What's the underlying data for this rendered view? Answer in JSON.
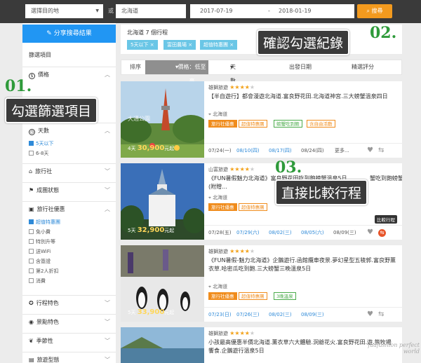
{
  "search": {
    "destination_placeholder": "選擇目的地",
    "or_label": "或",
    "keyword": "北海道",
    "date_from": "2017-07-19",
    "date_separator": "-",
    "date_to": "2018-01-19",
    "search_button": "搜尋"
  },
  "sidebar": {
    "share_button": "分享搜尋結果",
    "filter_heading": "篩選項目",
    "sections": [
      {
        "label": "價格",
        "icon": "dollar-icon"
      },
      {
        "label": "天數",
        "icon": "clock-icon",
        "options": [
          {
            "label": "5天以下",
            "checked": true
          },
          {
            "label": "6-8天",
            "checked": false
          }
        ]
      },
      {
        "label": "旅行社",
        "icon": "home-icon"
      },
      {
        "label": "成團狀態",
        "icon": "flag-icon"
      },
      {
        "label": "旅行社優惠",
        "icon": "gift-icon",
        "options": [
          {
            "label": "超值特惠團",
            "checked": true
          },
          {
            "label": "免小費",
            "checked": false
          },
          {
            "label": "特別升等",
            "checked": false
          },
          {
            "label": "送WiFi",
            "checked": false
          },
          {
            "label": "含簽證",
            "checked": false
          },
          {
            "label": "第2人折扣",
            "checked": false
          },
          {
            "label": "消費",
            "checked": false
          }
        ]
      },
      {
        "label": "行程特色",
        "icon": "star-icon"
      },
      {
        "label": "景點特色",
        "icon": "camera-icon"
      },
      {
        "label": "季節性",
        "icon": "leaf-icon"
      },
      {
        "label": "旅遊型態",
        "icon": "suitcase-icon"
      }
    ]
  },
  "filters": {
    "summary": "北海道 7 個行程",
    "chips": [
      "5天以下",
      "富田農場",
      "超值特惠團"
    ]
  },
  "sort": {
    "label": "排序",
    "active": "價格：低至高",
    "options": [
      "天數",
      "出發日期",
      "精選評分"
    ]
  },
  "results": [
    {
      "agency": "雄獅旅遊",
      "rating": 4,
      "title": "【半自遊行】都會漫遊北海道.富良野花田.北海道神宮.三大螃蟹溫泉四日",
      "location": "北海道",
      "tags": [
        {
          "label": "旅行社優惠",
          "style": "fill"
        },
        {
          "label": "超值特惠團",
          "style": "outline"
        },
        {
          "label": "螃蟹吃到飽",
          "style": "green"
        },
        {
          "label": "含自由活動",
          "style": "outline"
        }
      ],
      "days": "4天",
      "price": "30,900",
      "price_suffix": "元起",
      "photo_caption": "大通公園",
      "dates": [
        "07/24(一)",
        "08/10(四)",
        "08/17(四)",
        "08/24(四)"
      ],
      "more": "更多..."
    },
    {
      "agency": "山富旅遊",
      "rating": 4,
      "title": "《FUN暑假魅力北海道》富良野花田吃到飽螃蟹溫泉5日(附贈...",
      "title_right": "蟹吃到飽螃蟹溫泉",
      "location": "北海道",
      "tags": [
        {
          "label": "旅行社優惠",
          "style": "fill"
        },
        {
          "label": "超值特惠團",
          "style": "outline"
        }
      ],
      "days": "5天",
      "price": "32,900",
      "price_suffix": "元起",
      "dates": [
        "07/28(五)",
        "07/29(六)",
        "08/02(三)",
        "08/05(六)",
        "08/09(三)"
      ],
      "compare_tip": "比較行程"
    },
    {
      "agency": "雄獅旅遊",
      "rating": 4,
      "title": "《FUN暑假-魅力北海道》企鵝遊行.函館纜車夜景.夢幻星型五稜郭.富良野薰衣草.哈密瓜吃到飽.三大螃蟹三晚溫泉5日",
      "location": "北海道",
      "tags": [
        {
          "label": "旅行社優惠",
          "style": "fill"
        },
        {
          "label": "超值特惠團",
          "style": "outline"
        },
        {
          "label": "3晚溫泉",
          "style": "green"
        }
      ],
      "days": "5天",
      "price": "33,900",
      "price_suffix": "元起",
      "dates": [
        "07/23(日)",
        "07/26(三)",
        "08/02(三)",
        "08/09(三)"
      ]
    },
    {
      "agency": "雄獅旅遊",
      "rating": 4,
      "title": "小孩最高優惠半價北海道.薰衣草六大體驗.洞爺花火.富良野花田.遊.熊牧場饗食.企鵝遊行溫泉5日",
      "location": "北海道",
      "tags": [],
      "days": "",
      "price": "",
      "price_suffix": "",
      "dates": []
    }
  ],
  "annotations": {
    "step1_num": "01.",
    "step1_text": "勾選篩選項目",
    "step2_num": "02.",
    "step2_text": "確認勾選紀錄",
    "step3_num": "03.",
    "step3_text": "直接比較行程"
  },
  "watermark": "faafashion perfect world",
  "colors": {
    "accent": "#2196f3",
    "search": "#f39a1e",
    "chip": "#6ac6e6",
    "tag": "#f08c1c",
    "annotation": "#2e9a3a"
  }
}
